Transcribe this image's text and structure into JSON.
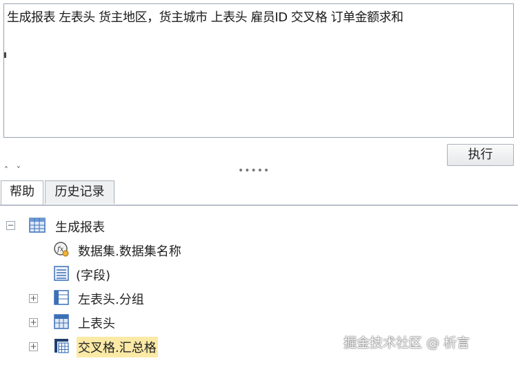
{
  "editor": {
    "text": "生成报表 左表头 货主地区，货主城市 上表头 雇员ID 交叉格 订单金额求和"
  },
  "toolbar": {
    "run_label": "执行",
    "collapse_label": "˄ ˅",
    "splitter": "•••••"
  },
  "tabs": [
    {
      "label": "帮助",
      "active": true
    },
    {
      "label": "历史记录",
      "active": false
    }
  ],
  "tree": {
    "root": {
      "label": "生成报表",
      "toggle": "⊟",
      "icon": "table-grid-icon"
    },
    "items": [
      {
        "label": "数据集.数据集名称",
        "toggle": "",
        "icon": "function-icon"
      },
      {
        "label": "(字段)",
        "toggle": "",
        "icon": "field-list-icon"
      },
      {
        "label": "左表头.分组",
        "toggle": "⊞",
        "icon": "left-header-icon"
      },
      {
        "label": "上表头",
        "toggle": "⊞",
        "icon": "top-header-icon"
      },
      {
        "label": "交叉格.汇总格",
        "toggle": "⊞",
        "icon": "cross-cell-icon",
        "selected": true
      }
    ]
  },
  "watermark": "掘金技术社区 @ 析言"
}
